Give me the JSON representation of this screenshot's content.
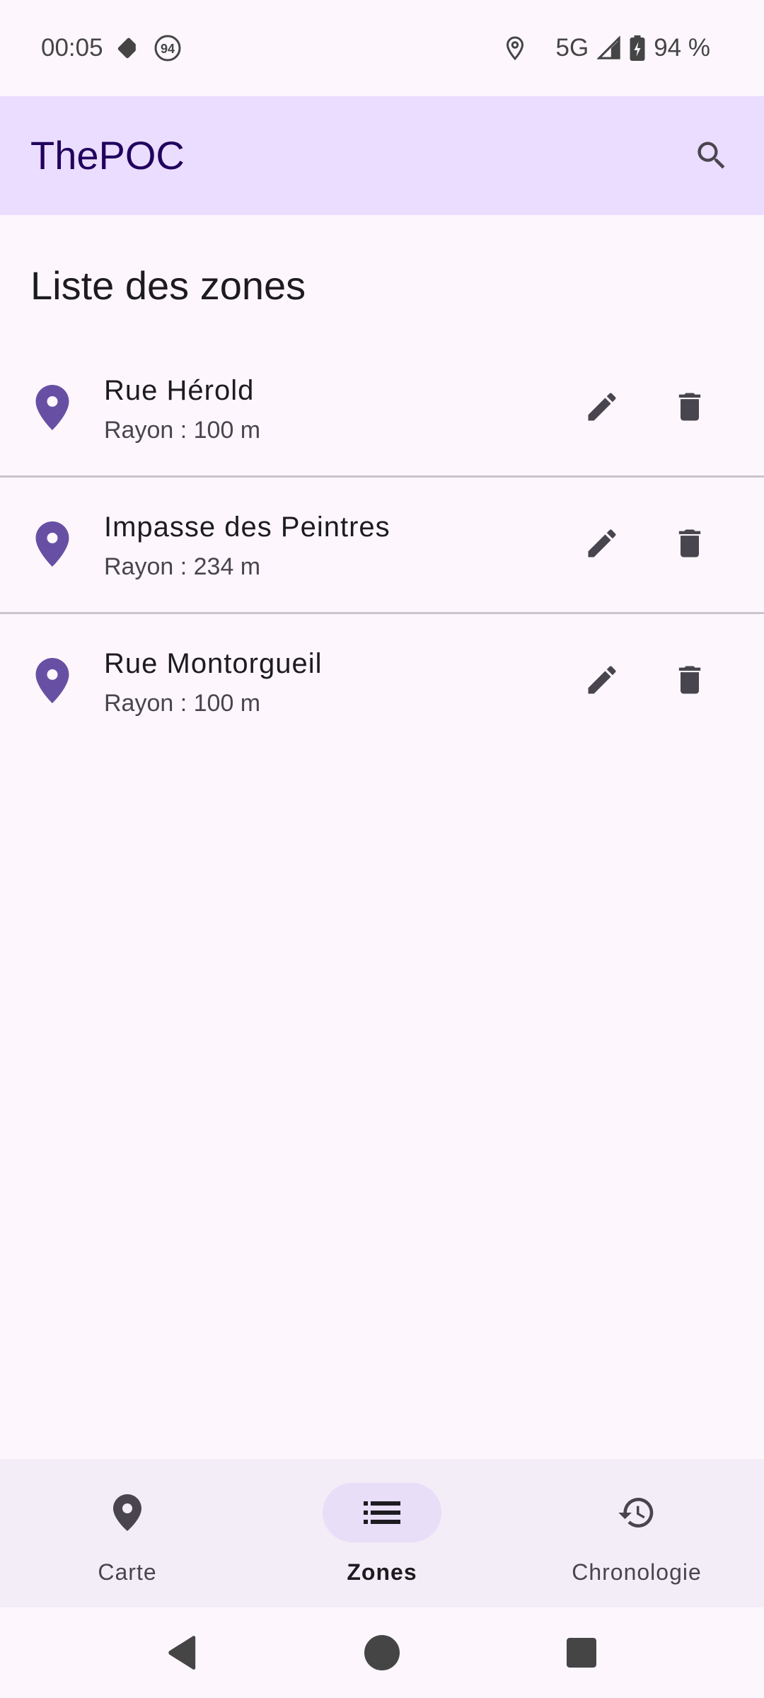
{
  "status_bar": {
    "time": "00:05",
    "badge_number": "94",
    "network": "5G",
    "battery": "94 %"
  },
  "app_bar": {
    "title": "ThePOC",
    "search_icon": "search-icon"
  },
  "section_title": "Liste des zones",
  "zones": [
    {
      "name": "Rue Hérold",
      "radius": "Rayon : 100 m"
    },
    {
      "name": "Impasse des Peintres",
      "radius": "Rayon : 234 m"
    },
    {
      "name": "Rue Montorgueil",
      "radius": "Rayon : 100 m"
    }
  ],
  "bottom_nav": {
    "items": [
      {
        "label": "Carte",
        "icon": "map-pin-icon",
        "active": false
      },
      {
        "label": "Zones",
        "icon": "list-icon",
        "active": true
      },
      {
        "label": "Chronologie",
        "icon": "history-icon",
        "active": false
      }
    ]
  },
  "colors": {
    "app_bar_bg": "#eaddff",
    "title_color": "#21005d",
    "pin_color": "#6750a4",
    "active_indicator": "#e8def8",
    "nav_bg": "#f3edf7"
  }
}
